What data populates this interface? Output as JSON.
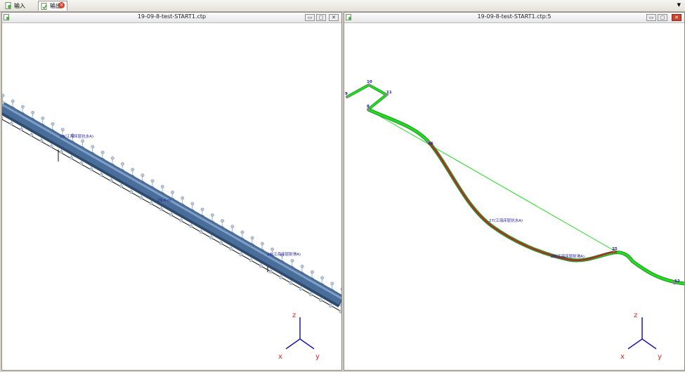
{
  "tabs": [
    {
      "label": "输入",
      "icon": "input-document-icon"
    },
    {
      "label": "输出",
      "icon": "output-document-icon"
    }
  ],
  "windows": {
    "left": {
      "title": "19-09-8-test-START1.ctp",
      "labels": {
        "support_a": "28(江海床层抗水A)",
        "middle": "29.4 m",
        "support_b": "28(江海床层耐滑A)"
      },
      "axes": {
        "z": "z",
        "x": "x",
        "y": "y"
      }
    },
    "right": {
      "title": "19-09-8-test-START1.ctp:5",
      "nodes": {
        "n9": "9",
        "n10": "10",
        "n11": "11",
        "n8": "8",
        "n26": "26",
        "n25": "25",
        "n12": "12"
      },
      "labels": {
        "curve_a": "27(江海床层抗水A)",
        "curve_b": "28(江海床层耐滑A)"
      },
      "axes": {
        "z": "z",
        "x": "x",
        "y": "y"
      }
    }
  },
  "colors": {
    "pipe": "#4a6e9a",
    "node_label": "#1a1aa8",
    "axis": "#e02020",
    "path_green": "#22dd22",
    "path_red": "#b02a2a"
  }
}
